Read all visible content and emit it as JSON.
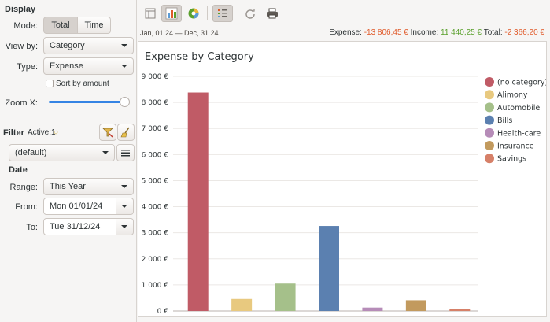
{
  "sidebar": {
    "display_title": "Display",
    "mode_label": "Mode:",
    "mode_options": [
      "Total",
      "Time"
    ],
    "viewby_label": "View by:",
    "viewby_value": "Category",
    "type_label": "Type:",
    "type_value": "Expense",
    "sort_label": "Sort by amount",
    "zoom_label": "Zoom X:",
    "zoom_level": 1.0,
    "filter_title": "Filter",
    "active_label": "Active:1",
    "filter_preset": "(default)",
    "date_title": "Date",
    "range_label": "Range:",
    "range_value": "This Year",
    "from_label": "From:",
    "from_value": "Mon 01/01/24",
    "to_label": "To:",
    "to_value": "Tue 31/12/24"
  },
  "toolbar": {
    "icons": [
      "table-view-icon",
      "bar-chart-icon",
      "pie-chart-icon",
      "legend-list-icon",
      "refresh-icon",
      "print-icon"
    ],
    "date_range": "Jan, 01 24 — Dec, 31 24",
    "expense_label": "Expense:",
    "expense_value": "-13 806,45 €",
    "income_label": "Income:",
    "income_value": "11 440,25 €",
    "total_label": "Total:",
    "total_value": "-2 366,20 €",
    "colors": {
      "expense": "#e05a2a",
      "income": "#5aa02c",
      "total": "#e05a2a"
    }
  },
  "chart_data": {
    "type": "bar",
    "title": "Expense by Category",
    "categories": [
      "(no category)",
      "Alimony",
      "Automobile",
      "Bills",
      "Health-care",
      "Insurance",
      "Savings"
    ],
    "values": [
      8380,
      460,
      1050,
      3260,
      130,
      410,
      90
    ],
    "colors": [
      "#c05b66",
      "#e8c97f",
      "#a5c08a",
      "#5b80b0",
      "#b68cb8",
      "#c29a5e",
      "#d68068"
    ],
    "ylim": [
      0,
      9000
    ],
    "yticks": [
      "0 €",
      "1 000 €",
      "2 000 €",
      "3 000 €",
      "4 000 €",
      "5 000 €",
      "6 000 €",
      "7 000 €",
      "8 000 €",
      "9 000 €"
    ],
    "grid": true,
    "legend_position": "right"
  }
}
